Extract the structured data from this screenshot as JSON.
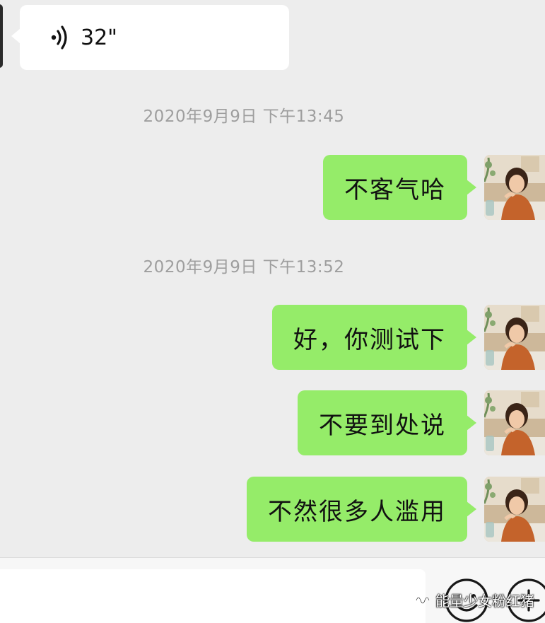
{
  "incoming": {
    "voice_icon": "voice-wave-icon",
    "voice_duration": "32\""
  },
  "conversation": [
    {
      "timestamp": "2020年9月9日 下午13:45"
    },
    {
      "text": "不客气哈"
    },
    {
      "timestamp": "2020年9月9日 下午13:52"
    },
    {
      "text": "好，你测试下"
    },
    {
      "text": "不要到处说"
    },
    {
      "text": "不然很多人滥用"
    }
  ],
  "input_bar": {
    "placeholder": "",
    "emoji_icon": "emoji-smile-icon",
    "plus_icon": "plus-circle-icon"
  },
  "watermark": {
    "label": "能量少女粉红猪",
    "icon": "wechat-channel-icon"
  },
  "colors": {
    "background": "#ededed",
    "outgoing_bubble": "#95ec69",
    "incoming_bubble": "#ffffff",
    "timestamp_text": "#9e9e9e"
  }
}
